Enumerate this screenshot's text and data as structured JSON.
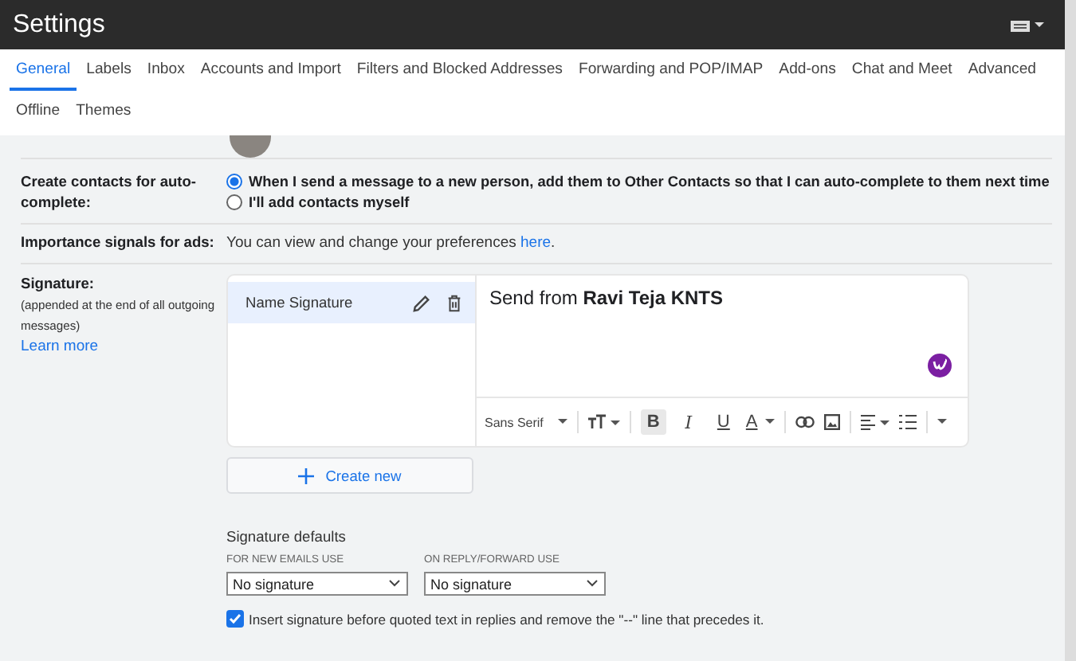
{
  "window": {
    "title": "Settings"
  },
  "tab_rows": [
    [
      {
        "label": "General",
        "selected": true
      },
      {
        "label": "Labels",
        "selected": false
      },
      {
        "label": "Inbox",
        "selected": false
      },
      {
        "label": "Accounts and Import",
        "selected": false
      },
      {
        "label": "Filters and Blocked Addresses",
        "selected": false
      },
      {
        "label": "Forwarding and POP/IMAP",
        "selected": false
      },
      {
        "label": "Add-ons",
        "selected": false
      },
      {
        "label": "Chat and Meet",
        "selected": false
      },
      {
        "label": "Advanced",
        "selected": false
      }
    ],
    [
      {
        "label": "Offline",
        "selected": false
      },
      {
        "label": "Themes",
        "selected": false
      }
    ]
  ],
  "contacts": {
    "label": "Create contacts for auto-complete:",
    "options": [
      {
        "label": "When I send a message to a new person, add them to Other Contacts so that I can auto-complete to them next time",
        "selected": true
      },
      {
        "label": "I'll add contacts myself",
        "selected": false
      }
    ]
  },
  "importance": {
    "label": "Importance signals for ads:",
    "text": "You can view and change your preferences ",
    "link": "here",
    "after": "."
  },
  "signature": {
    "label": "Signature:",
    "note": "(appended at the end of all outgoing messages)",
    "learn_more": "Learn more",
    "items": [
      {
        "name": "Name Signature",
        "selected": true
      }
    ],
    "editor_text": "Send from **Ravi Teja KNTS**",
    "toolbar": [
      {
        "kind": "font",
        "label": "Sans Serif"
      },
      {
        "kind": "sep"
      },
      {
        "kind": "size"
      },
      {
        "kind": "sep"
      },
      {
        "kind": "letter",
        "label": "B",
        "selected": true
      },
      {
        "kind": "letter",
        "label": "I",
        "selected": false
      },
      {
        "kind": "letter",
        "label": "U",
        "selected": false
      },
      {
        "kind": "color",
        "label": "A"
      },
      {
        "kind": "sep"
      },
      {
        "kind": "link"
      },
      {
        "kind": "image"
      },
      {
        "kind": "sep"
      },
      {
        "kind": "align"
      },
      {
        "kind": "list"
      },
      {
        "kind": "sep"
      },
      {
        "kind": "more"
      }
    ],
    "create_new": "Create new"
  },
  "defaults": {
    "title": "Signature defaults",
    "selects": [
      {
        "label": "FOR NEW EMAILS USE",
        "value": "No signature"
      },
      {
        "label": "ON REPLY/FORWARD USE",
        "value": "No signature"
      }
    ],
    "insert": {
      "label": "Insert signature before quoted text in replies and remove the \"--\" line that precedes it.",
      "checked": true
    }
  }
}
